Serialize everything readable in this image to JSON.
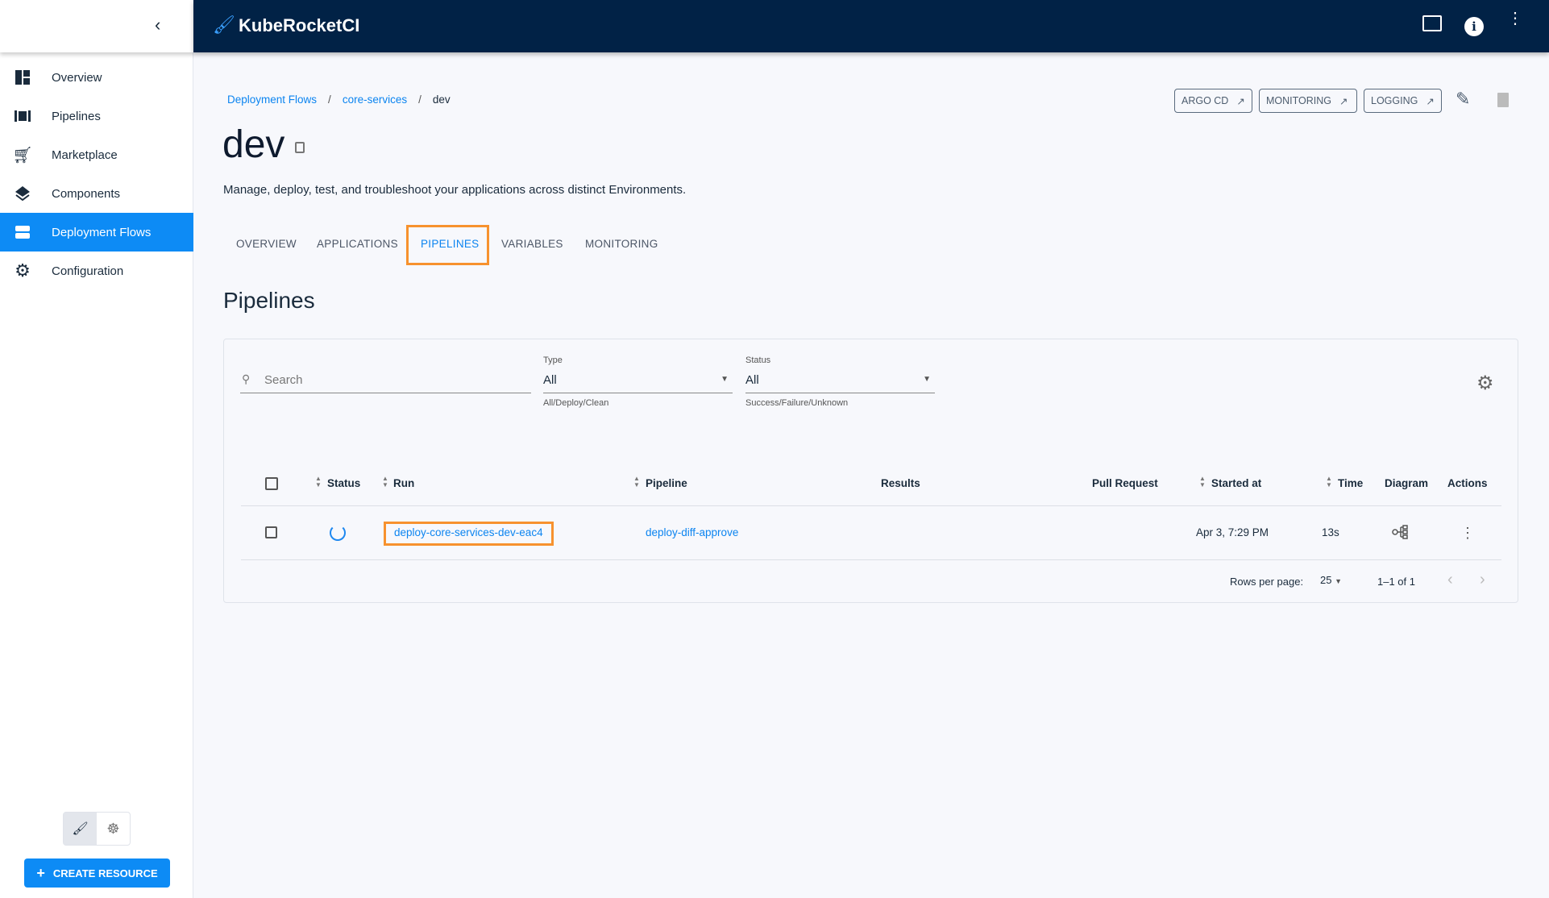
{
  "app": {
    "title": "KubeRocketCI"
  },
  "sidebar": {
    "items": [
      {
        "label": "Overview"
      },
      {
        "label": "Pipelines"
      },
      {
        "label": "Marketplace"
      },
      {
        "label": "Components"
      },
      {
        "label": "Deployment Flows"
      },
      {
        "label": "Configuration"
      }
    ],
    "create_label": "CREATE RESOURCE"
  },
  "breadcrumb": {
    "items": [
      "Deployment Flows",
      "core-services",
      "dev"
    ]
  },
  "page": {
    "title": "dev",
    "description": "Manage, deploy, test, and troubleshoot your applications across distinct Environments."
  },
  "actions": {
    "argo": "ARGO CD",
    "monitoring": "MONITORING",
    "logging": "LOGGING"
  },
  "tabs": [
    "OVERVIEW",
    "APPLICATIONS",
    "PIPELINES",
    "VARIABLES",
    "MONITORING"
  ],
  "section": {
    "title": "Pipelines"
  },
  "filters": {
    "search_placeholder": "Search",
    "type_label": "Type",
    "type_value": "All",
    "type_help": "All/Deploy/Clean",
    "status_label": "Status",
    "status_value": "All",
    "status_help": "Success/Failure/Unknown"
  },
  "table": {
    "headers": [
      "Status",
      "Run",
      "Pipeline",
      "Results",
      "Pull Request",
      "Started at",
      "Time",
      "Diagram",
      "Actions"
    ],
    "rows": [
      {
        "run": "deploy-core-services-dev-eac4",
        "pipeline": "deploy-diff-approve",
        "started": "Apr 3, 7:29 PM",
        "time": "13s"
      }
    ]
  },
  "pagination": {
    "rows_label": "Rows per page:",
    "rows_value": "25",
    "range": "1–1 of 1"
  },
  "colors": {
    "header": "#012246",
    "accent": "#0d8bf5",
    "highlight": "#f7922e"
  }
}
